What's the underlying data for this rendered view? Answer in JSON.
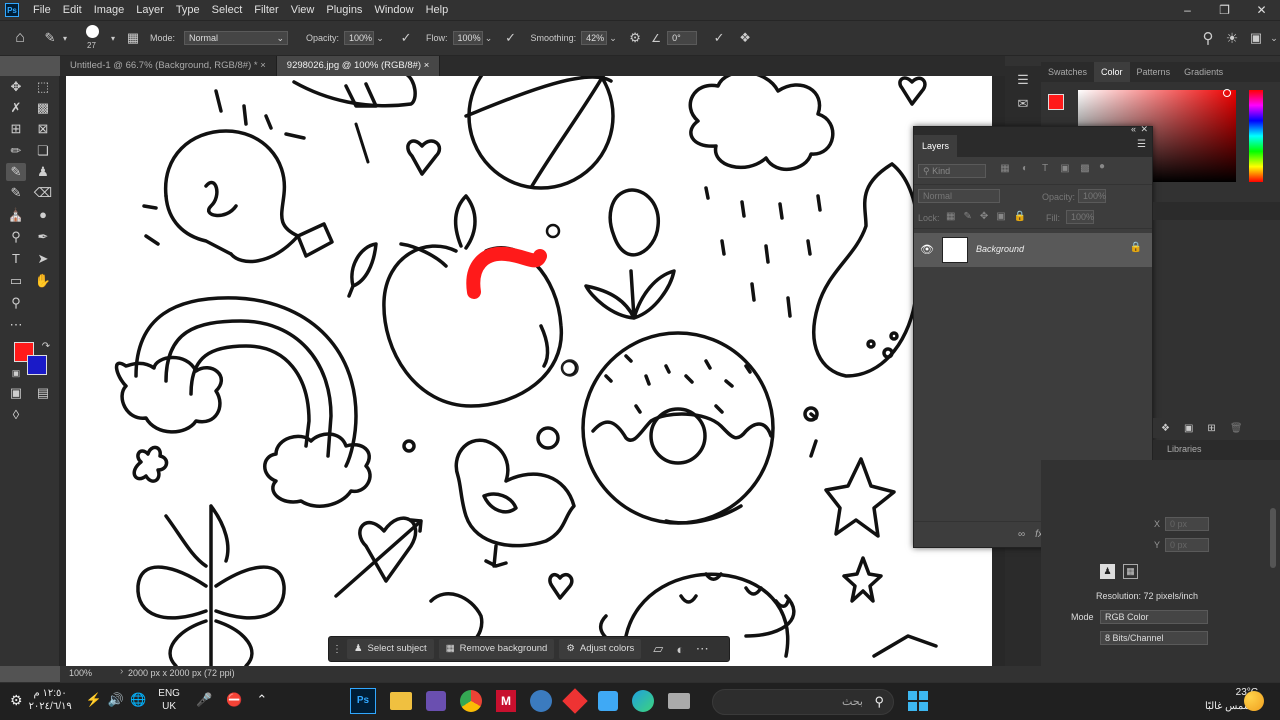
{
  "app": {
    "title": "Adobe Photoshop",
    "logo": "Ps"
  },
  "menu": [
    "File",
    "Edit",
    "Image",
    "Layer",
    "Type",
    "Select",
    "Filter",
    "View",
    "Plugins",
    "Window",
    "Help"
  ],
  "options_bar": {
    "brush_size": "27",
    "mode_label": "Mode:",
    "mode_value": "Normal",
    "opacity_label": "Opacity:",
    "opacity_value": "100%",
    "flow_label": "Flow:",
    "flow_value": "100%",
    "smoothing_label": "Smoothing:",
    "smoothing_value": "42%",
    "angle_value": "0°"
  },
  "tabs": [
    {
      "label": "Untitled-1 @ 66.7% (Background, RGB/8#) *",
      "close": "×"
    },
    {
      "label": "9298026.jpg @ 100% (RGB/8#)",
      "close": "×"
    }
  ],
  "colors": {
    "foreground": "#ff1a1a",
    "background": "#1a1ac8",
    "accent": "#31a8ff"
  },
  "status": {
    "zoom": "100%",
    "doc_info": "2000 px x 2000 px (72 ppi)"
  },
  "color_panel": {
    "tabs": [
      "Swatches",
      "Color",
      "Patterns",
      "Gradients"
    ],
    "active": "Color"
  },
  "layers_panel": {
    "title": "Layers",
    "kind_placeholder": "Kind",
    "blend_mode": "Normal",
    "opacity_label": "Opacity:",
    "opacity_value": "100%",
    "lock_label": "Lock:",
    "fill_label": "Fill:",
    "fill_value": "100%",
    "layers": [
      {
        "name": "Background",
        "visible": true,
        "locked": true
      }
    ],
    "footer_icons": [
      "link-icon",
      "fx-icon",
      "mask-icon",
      "adjustment-icon",
      "folder-icon",
      "new-layer-icon",
      "trash-icon"
    ]
  },
  "properties_panel": {
    "tab": "Libraries",
    "x_label": "X",
    "x_value": "0 px",
    "y_label": "Y",
    "y_value": "0 px",
    "resolution": "Resolution: 72 pixels/inch",
    "mode_label": "Mode",
    "mode_value": "RGB Color",
    "depth_value": "8 Bits/Channel"
  },
  "context_bar": {
    "select_subject": "Select subject",
    "remove_background": "Remove background",
    "adjust_colors": "Adjust colors"
  },
  "taskbar": {
    "search_placeholder": "بحث",
    "time": "١٢:٥٠ م",
    "date": "٢٠٢٤/٦/١٩",
    "lang_top": "ENG",
    "lang_bottom": "UK",
    "weather_temp": "23°C",
    "weather_desc": "مشمس غالبًا"
  }
}
